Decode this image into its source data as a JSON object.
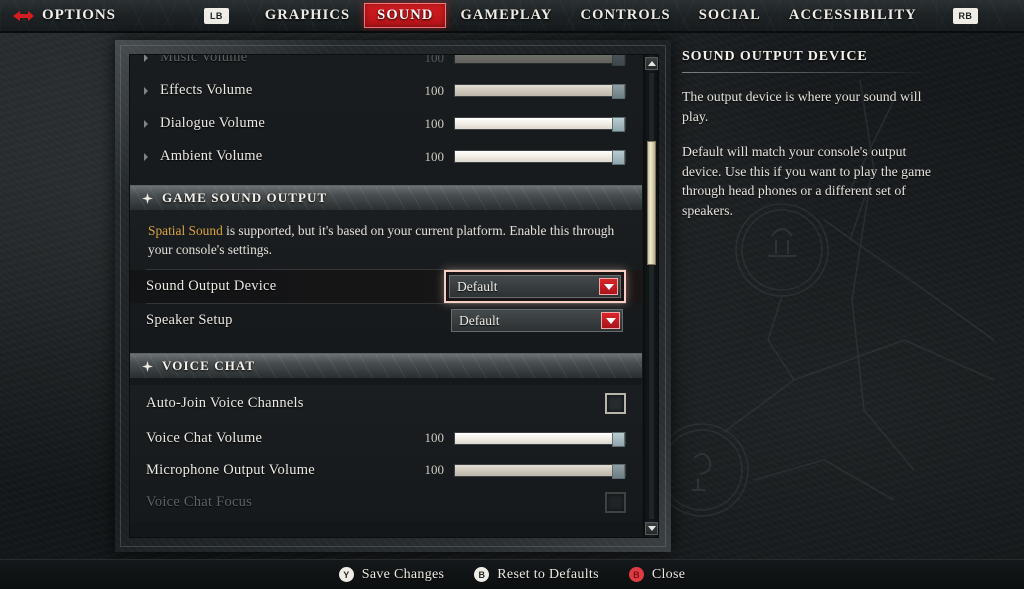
{
  "topbar": {
    "arrow_icon": "options-arrow-icon",
    "title": "OPTIONS",
    "left_bumper": "LB",
    "right_bumper": "RB",
    "tabs": [
      {
        "label": "GRAPHICS",
        "active": false
      },
      {
        "label": "SOUND",
        "active": true
      },
      {
        "label": "GAMEPLAY",
        "active": false
      },
      {
        "label": "CONTROLS",
        "active": false
      },
      {
        "label": "SOCIAL",
        "active": false
      },
      {
        "label": "ACCESSIBILITY",
        "active": false
      }
    ]
  },
  "settings": {
    "volume_rows": [
      {
        "label": "Music Volume",
        "value": "100",
        "faded": true
      },
      {
        "label": "Effects Volume",
        "value": "100",
        "faded": false
      },
      {
        "label": "Dialogue Volume",
        "value": "100",
        "faded": false
      },
      {
        "label": "Ambient Volume",
        "value": "100",
        "faded": false
      }
    ],
    "game_sound_output": {
      "title": "GAME SOUND OUTPUT",
      "note_highlight": "Spatial Sound",
      "note_rest": " is supported, but it's based on your current platform. Enable this through your console's settings.",
      "rows": [
        {
          "label": "Sound Output Device",
          "value": "Default",
          "selected": true
        },
        {
          "label": "Speaker Setup",
          "value": "Default",
          "selected": false
        }
      ]
    },
    "voice_chat": {
      "title": "VOICE CHAT",
      "rows": [
        {
          "label": "Auto-Join Voice Channels",
          "type": "checkbox",
          "checked": false,
          "faded": false
        },
        {
          "label": "Voice Chat Volume",
          "type": "slider",
          "value": "100",
          "faded": false
        },
        {
          "label": "Microphone Output Volume",
          "type": "slider",
          "value": "100",
          "faded": false
        },
        {
          "label": "Voice Chat Focus",
          "type": "checkbox",
          "checked": false,
          "faded": true
        }
      ]
    }
  },
  "info": {
    "title": "SOUND OUTPUT DEVICE",
    "paragraph1": "The output device is where your sound will play.",
    "paragraph2": "Default will match your console's output device. Use this if you want to play the game through head phones or a different set of speakers."
  },
  "footer": {
    "buttons": [
      {
        "glyph": "Y",
        "label": "Save Changes",
        "style": "light"
      },
      {
        "glyph": "B",
        "label": "Reset to Defaults",
        "style": "light"
      },
      {
        "glyph": "B",
        "label": "Close",
        "style": "red"
      }
    ]
  },
  "colors": {
    "accent_red": "#d41d20",
    "highlight_gold": "#d9a441",
    "selection_glow": "#f6cfc2"
  }
}
